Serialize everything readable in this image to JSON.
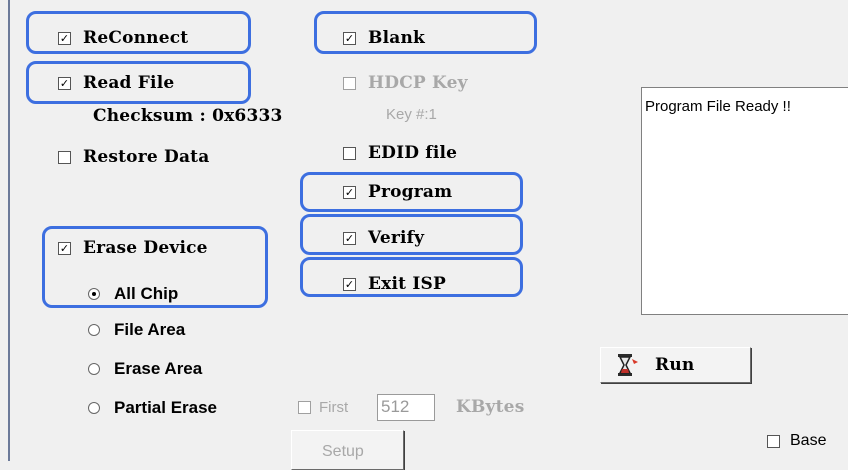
{
  "options": {
    "reconnect": "ReConnect",
    "read_file": "Read File",
    "checksum": "Checksum : 0x6333",
    "restore_data": "Restore Data",
    "blank": "Blank",
    "hdcp_key": "HDCP Key",
    "key_no": "Key #:1",
    "edid_file": "EDID file",
    "program": "Program",
    "verify": "Verify",
    "exit_isp": "Exit ISP",
    "erase_device": "Erase Device"
  },
  "erase_modes": {
    "all_chip": "All Chip",
    "file_area": "File Area",
    "erase_area": "Erase Area",
    "partial_erase": "Partial Erase"
  },
  "partial": {
    "first_label": "First",
    "first_value": "512",
    "unit": "KBytes"
  },
  "log": {
    "text": "Program File Ready !!"
  },
  "buttons": {
    "run": "Run",
    "setup": "Setup"
  },
  "base": {
    "label": "Base"
  },
  "checkmark": "✓",
  "accent_color": "#3d6fe0"
}
